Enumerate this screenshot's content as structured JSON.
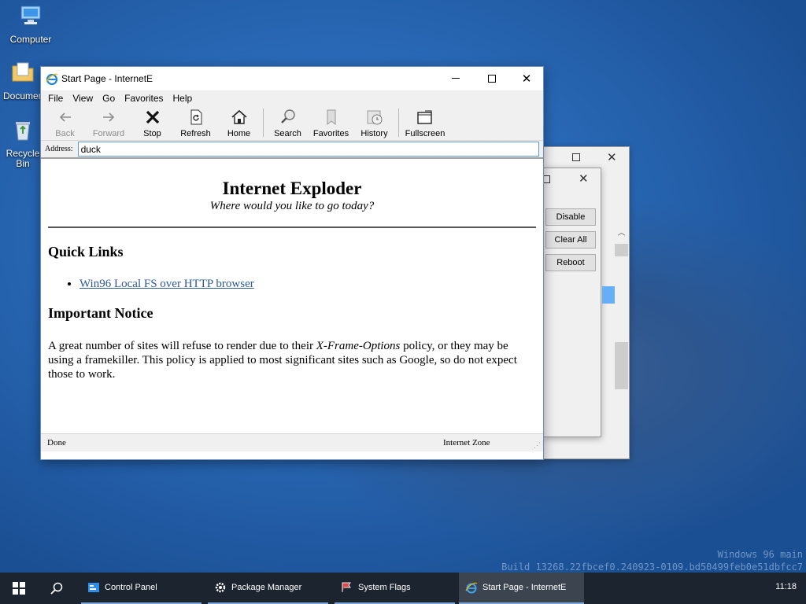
{
  "desktop": {
    "icons": [
      {
        "label": "Computer"
      },
      {
        "label": "Documents"
      },
      {
        "label": "Recycle Bin"
      }
    ],
    "watermark": [
      "Windows 96 main",
      "Build 13268.22fbcef0.240923-0109.bd50499feb0e51dbfcc7"
    ]
  },
  "back_window": {
    "buttons": [
      "Disable",
      "Clear All",
      "Reboot"
    ]
  },
  "browser": {
    "title": "Start Page - InternetE",
    "menu": [
      "File",
      "View",
      "Go",
      "Favorites",
      "Help"
    ],
    "toolbar": [
      {
        "label": "Back",
        "icon": "back-arrow-icon",
        "enabled": false
      },
      {
        "label": "Forward",
        "icon": "forward-arrow-icon",
        "enabled": false
      },
      {
        "label": "Stop",
        "icon": "stop-x-icon",
        "enabled": true
      },
      {
        "label": "Refresh",
        "icon": "refresh-icon",
        "enabled": true
      },
      {
        "label": "Home",
        "icon": "home-icon",
        "enabled": true
      },
      {
        "label": "Search",
        "icon": "search-icon",
        "enabled": true
      },
      {
        "label": "Favorites",
        "icon": "favorites-icon",
        "enabled": true
      },
      {
        "label": "History",
        "icon": "history-icon",
        "enabled": true
      },
      {
        "label": "Fullscreen",
        "icon": "fullscreen-icon",
        "enabled": true
      }
    ],
    "address_label": "Address:",
    "address_value": "duck",
    "page": {
      "heading": "Internet Exploder",
      "subtitle": "Where would you like to go today?",
      "quick_links_heading": "Quick Links",
      "quick_links": [
        "Win96 Local FS over HTTP browser"
      ],
      "notice_heading": "Important Notice",
      "notice_before": "A great number of sites will refuse to render due to their ",
      "notice_em": "X-Frame-Options",
      "notice_after": " policy, or they may be using a framekiller. This policy is applied to most significant sites such as Google, so do not expect those to work."
    },
    "status_left": "Done",
    "status_right": "Internet Zone"
  },
  "taskbar": {
    "apps": [
      {
        "label": "Control Panel",
        "active": false
      },
      {
        "label": "Package Manager",
        "active": false
      },
      {
        "label": "System Flags",
        "active": false
      },
      {
        "label": "Start Page - InternetE",
        "active": true
      }
    ],
    "clock": "11:18"
  },
  "colors": {
    "link": "#2d5a96",
    "taskbar": "#1c2430",
    "taskbar_underline": "#7aa7d8",
    "window_border": "#6c8dbd"
  }
}
